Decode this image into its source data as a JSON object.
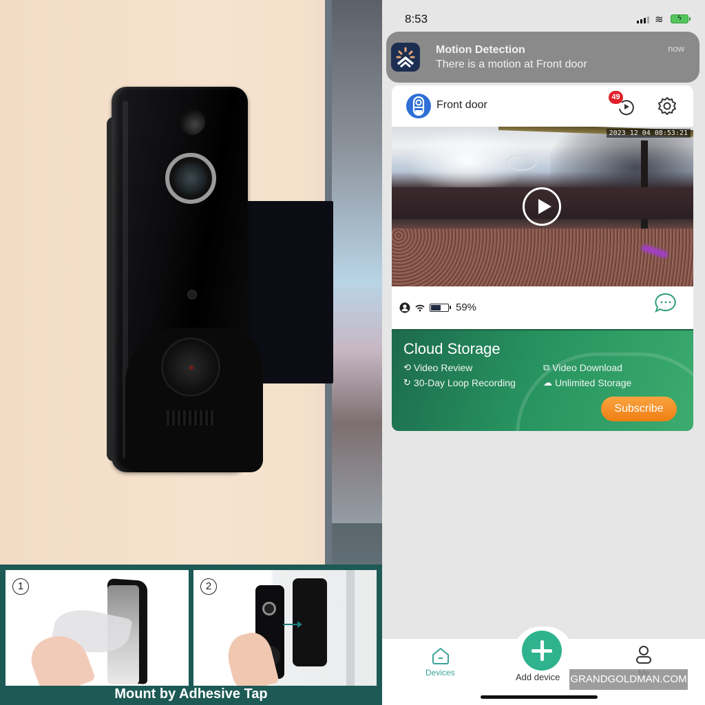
{
  "product_photo": {
    "alt": "Black video doorbell mounted on wall with black bracket"
  },
  "install_banner": {
    "steps": [
      {
        "number": "1",
        "description": "Peel adhesive film from mount"
      },
      {
        "number": "2",
        "description": "Slide doorbell onto mount"
      }
    ],
    "caption": "Mount by Adhesive Tap",
    "colors": {
      "background": "#1d5a55"
    }
  },
  "phone": {
    "status_bar": {
      "time": "8:53",
      "icons": [
        "cellular-signal-icon",
        "wifi-icon",
        "battery-charging-icon"
      ]
    },
    "notification": {
      "app_icon": "app-logo-icon",
      "title": "Motion Detection",
      "body": "There is a motion at Front door",
      "time": "now"
    },
    "device_card": {
      "device_icon": "doorbell-icon",
      "device_name": "Front door",
      "playback_badge": "49",
      "playback_icon": "replay-icon",
      "settings_icon": "gear-icon",
      "video": {
        "timestamp": "2023 12 04 08:53:21",
        "play_icon": "play-icon"
      },
      "status": {
        "person_icon": "person-icon",
        "wifi_icon": "wifi-icon",
        "battery_icon": "battery-icon",
        "battery_percent": "59%",
        "battery_level": 0.59,
        "message_icon": "chat-bubble-icon"
      },
      "cloud_storage": {
        "title": "Cloud Storage",
        "features": [
          {
            "icon": "history-icon",
            "glyph": "⟲",
            "label": "Video Review"
          },
          {
            "icon": "video-download-icon",
            "glyph": "⧉",
            "label": "Video Download"
          },
          {
            "icon": "loop-icon",
            "glyph": "↻",
            "label": "30-Day Loop Recording"
          },
          {
            "icon": "cloud-icon",
            "glyph": "☁",
            "label": "Unlimited Storage"
          }
        ],
        "subscribe_label": "Subscribe",
        "colors": {
          "from": "#1c6a4c",
          "to": "#3cac6e",
          "button": "#f07e12"
        }
      }
    },
    "tab_bar": {
      "tabs": [
        {
          "icon": "home-icon",
          "label": "Devices",
          "active": true
        },
        {
          "icon": "plus-icon",
          "label": "Add device",
          "active": false
        },
        {
          "icon": "user-icon",
          "label": "Me",
          "active": false
        }
      ],
      "accent": "#2fb38e"
    },
    "watermark": "GRANDGOLDMAN.COM"
  }
}
